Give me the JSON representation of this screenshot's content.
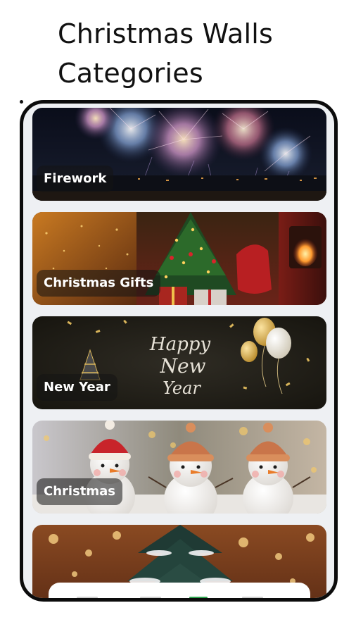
{
  "header": {
    "title": "Christmas Walls Categories"
  },
  "categories": [
    {
      "label": "Firework",
      "icon": "firework-thumbnail"
    },
    {
      "label": "Christmas Gifts",
      "icon": "christmas-gifts-thumbnail"
    },
    {
      "label": "New Year",
      "icon": "new-year-thumbnail",
      "art_text_1": "Happy",
      "art_text_2": "New",
      "art_text_3": "Year"
    },
    {
      "label": "Christmas",
      "icon": "snowmen-thumbnail"
    },
    {
      "label": "",
      "icon": "christmas-tree-thumbnail"
    }
  ],
  "colors": {
    "background": "#ffffff",
    "phone_frame": "#0c0c0c",
    "screen": "#eef0f3",
    "label_bg": "#141414",
    "label_text": "#ffffff",
    "nav_accent": "#2ea44f"
  }
}
